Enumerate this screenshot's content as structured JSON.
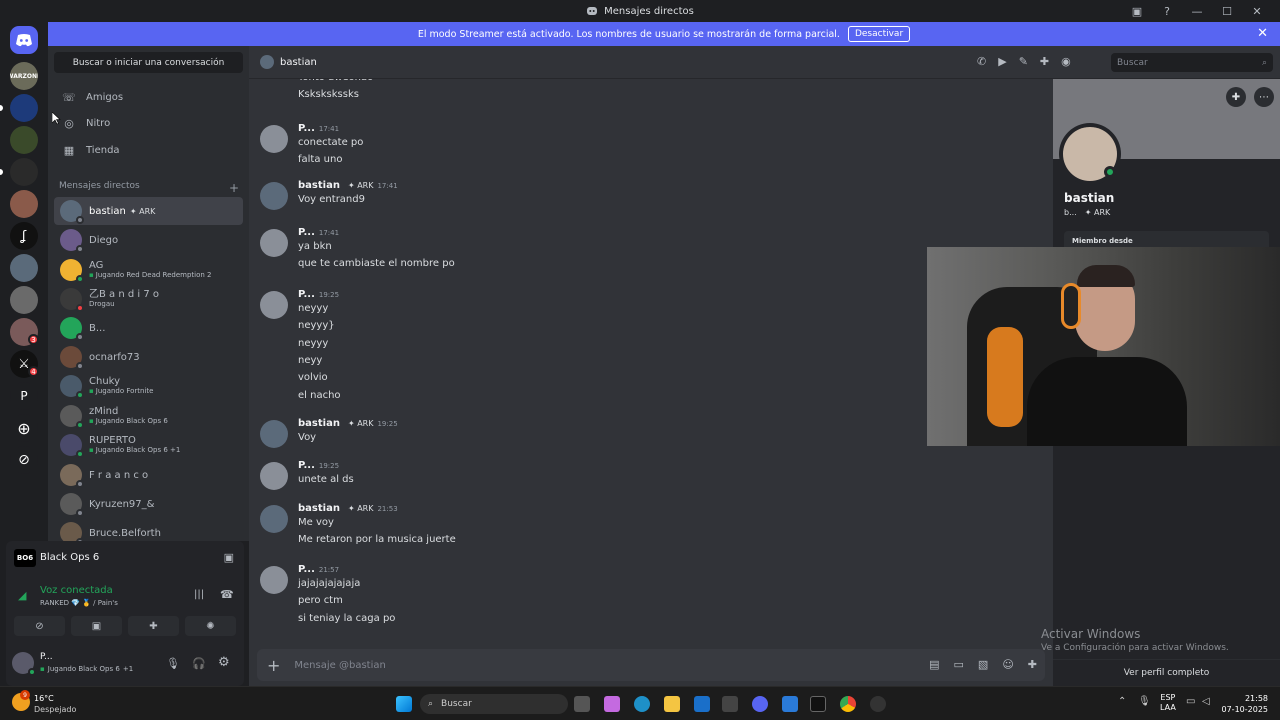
{
  "window": {
    "title": "Mensajes directos"
  },
  "banner": {
    "text": "El modo Streamer está activado. Los nombres de usuario se mostrarán de forma parcial.",
    "button": "Desactivar"
  },
  "sidebar": {
    "search_button": "Buscar o iniciar una conversación",
    "nav": [
      {
        "label": "Amigos",
        "icon": "friends-icon"
      },
      {
        "label": "Nitro",
        "icon": "nitro-icon"
      },
      {
        "label": "Tienda",
        "icon": "shop-icon"
      }
    ],
    "dm_header": "Mensajes directos",
    "dm_add": "+",
    "dms": [
      {
        "name": "bastian",
        "tag": "ARK",
        "status": "",
        "active": true,
        "color": "#5b6a7a",
        "presence": "#80848e"
      },
      {
        "name": "Diego",
        "tag": "",
        "status": "",
        "color": "#6b5b8a",
        "presence": "#80848e"
      },
      {
        "name": "AG",
        "tag": "",
        "status": "Jugando Red Dead Redemption 2",
        "color": "#f0b232",
        "presence": "#23a55a"
      },
      {
        "name": "乙B a n d i 7 o",
        "tag": "",
        "status": "Drogau",
        "color": "#3a3a3a",
        "presence": "#f23f43"
      },
      {
        "name": "B...",
        "tag": "",
        "status": "",
        "color": "#23a55a",
        "presence": "#80848e"
      },
      {
        "name": "ocnarfo73",
        "tag": "",
        "status": "",
        "color": "#6b4a3a",
        "presence": "#80848e"
      },
      {
        "name": "Chuky",
        "tag": "",
        "status": "Jugando Fortnite",
        "color": "#4a5a6a",
        "presence": "#23a55a"
      },
      {
        "name": "zMind",
        "tag": "",
        "status": "Jugando Black Ops 6",
        "color": "#5a5a5a",
        "presence": "#23a55a"
      },
      {
        "name": "RUPERTO",
        "tag": "",
        "status": "Jugando Black Ops 6 +1",
        "color": "#4a4a6a",
        "presence": "#23a55a"
      },
      {
        "name": "F r a a n c o",
        "tag": "",
        "status": "",
        "color": "#7a6a5a",
        "presence": "#80848e"
      },
      {
        "name": "Kyruzen97_&",
        "tag": "",
        "status": "",
        "color": "#5a5a5a",
        "presence": "#80848e"
      },
      {
        "name": "Bruce.Belforth",
        "tag": "",
        "status": "",
        "color": "#6a5a4a",
        "presence": "#80848e"
      }
    ]
  },
  "activity": {
    "game": "Black Ops 6"
  },
  "voice": {
    "status": "Voz conectada",
    "detail": "RANKED 💎 🥇 / Pain's"
  },
  "user": {
    "name": "P...",
    "status": "Jugando Black Ops 6",
    "extra": "+1"
  },
  "chat": {
    "recipient": "bastian",
    "search_placeholder": "Buscar",
    "composer_placeholder": "Mensaje @bastian",
    "messages": [
      {
        "author": "",
        "tag": "",
        "time": "",
        "lines": [
          "Tonto aweonao",
          "Kskskskssks"
        ]
      },
      {
        "author": "P...",
        "tag": "",
        "time": "17:41",
        "lines": [
          "conectate po",
          "falta uno"
        ]
      },
      {
        "author": "bastian",
        "tag": "ARK",
        "time": "17:41",
        "lines": [
          "Voy entrand9"
        ]
      },
      {
        "author": "P...",
        "tag": "",
        "time": "17:41",
        "lines": [
          "ya bkn",
          "que te cambiaste el nombre po"
        ]
      },
      {
        "author": "P...",
        "tag": "",
        "time": "19:25",
        "lines": [
          "neyyy",
          "neyyy}",
          "neyyy",
          "neyy",
          "volvio",
          "el nacho"
        ]
      },
      {
        "author": "bastian",
        "tag": "ARK",
        "time": "19:25",
        "lines": [
          "Voy"
        ]
      },
      {
        "author": "P...",
        "tag": "",
        "time": "19:25",
        "lines": [
          "unete al ds"
        ]
      },
      {
        "author": "bastian",
        "tag": "ARK",
        "time": "21:53",
        "lines": [
          "Me voy",
          "Me retaron por la musica juerte"
        ]
      },
      {
        "author": "P...",
        "tag": "",
        "time": "21:57",
        "lines": [
          "jajajajajajaja",
          "pero ctm",
          "si teniay la caga po"
        ]
      }
    ]
  },
  "profile": {
    "name": "bastian",
    "sub": "b...",
    "tag": "ARK",
    "member_since": "Miembro desde",
    "view_full": "Ver perfil completo"
  },
  "watermark": {
    "title": "Activar Windows",
    "body": "Ve a Configuración para activar Windows."
  },
  "taskbar": {
    "weather_temp": "16°C",
    "weather_desc": "Despejado",
    "weather_badge": "9",
    "search": "Buscar",
    "lang1": "ESP",
    "lang2": "LAA",
    "time": "21:58",
    "date": "07-10-2025"
  },
  "guild_badges": [
    "3",
    "4"
  ],
  "colors": {
    "blurple": "#5865f2",
    "online": "#23a55a",
    "dnd": "#f23f43"
  }
}
